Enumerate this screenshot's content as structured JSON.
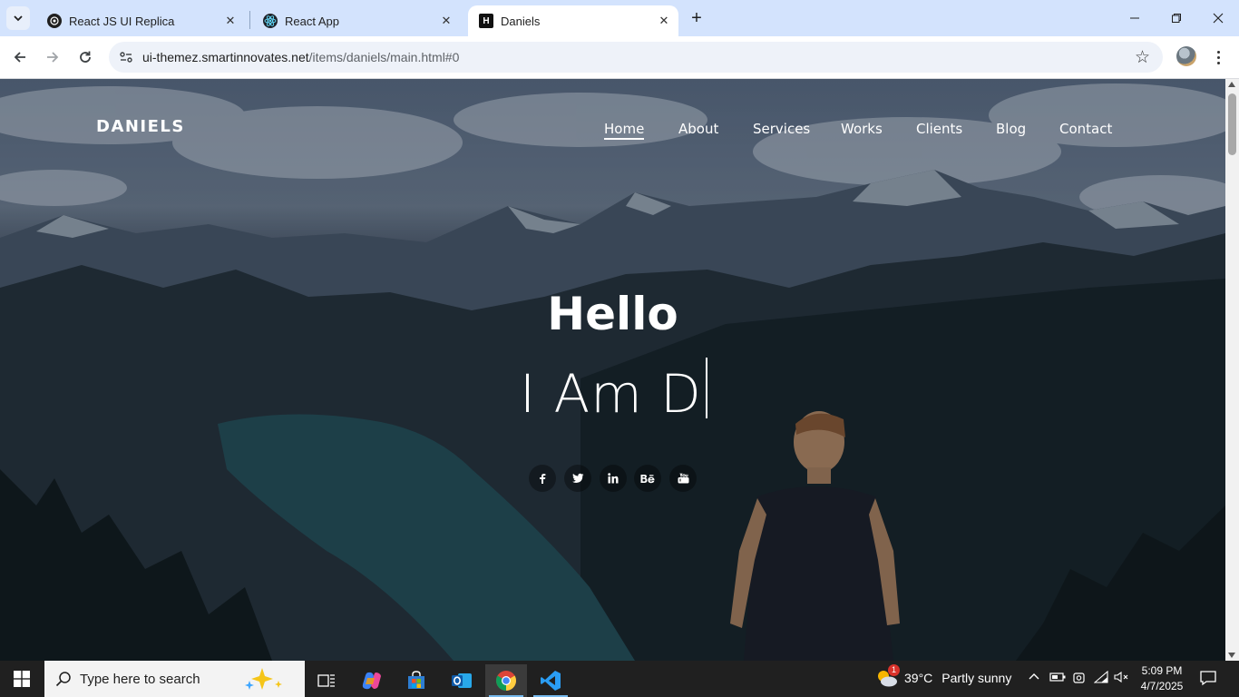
{
  "browser": {
    "tabs": [
      {
        "title": "React JS UI Replica",
        "favicon": "openai-logo-icon",
        "active": false
      },
      {
        "title": "React App",
        "favicon": "react-logo-icon",
        "active": false
      },
      {
        "title": "Daniels",
        "favicon": "h-logo-icon",
        "active": true
      }
    ],
    "url_host": "ui-themez.smartinnovates.net",
    "url_path": "/items/daniels/main.html#0"
  },
  "site": {
    "brand": "DANIELS",
    "nav": [
      "Home",
      "About",
      "Services",
      "Works",
      "Clients",
      "Blog",
      "Contact"
    ],
    "active_nav": "Home",
    "hero_title": "Hello",
    "hero_typed": "I Am D",
    "socials": [
      {
        "icon": "facebook-icon",
        "glyph": "f"
      },
      {
        "icon": "twitter-icon",
        "glyph": "🐦"
      },
      {
        "icon": "linkedin-icon",
        "glyph": "in"
      },
      {
        "icon": "behance-icon",
        "glyph": "Bē"
      },
      {
        "icon": "youtube-icon",
        "glyph": "▶"
      }
    ]
  },
  "taskbar": {
    "search_placeholder": "Type here to search",
    "weather_temp": "39°C",
    "weather_text": "Partly sunny",
    "weather_badge": "1",
    "time": "5:09 PM",
    "date": "4/7/2025"
  },
  "colors": {
    "tab_strip": "#d3e3fd",
    "taskbar": "#202020",
    "accent": "#76b9ed"
  }
}
